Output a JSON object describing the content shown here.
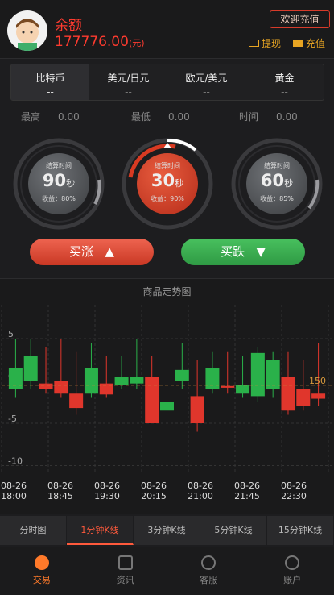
{
  "header": {
    "balance_label": "余额",
    "balance_value": "177776.00",
    "balance_unit": "(元)",
    "welcome_label": "欢迎充值",
    "withdraw_label": "提现",
    "recharge_label": "充值"
  },
  "market_tabs": [
    {
      "name": "比特币",
      "value": "--"
    },
    {
      "name": "美元/日元",
      "value": "--"
    },
    {
      "name": "欧元/美元",
      "value": "--"
    },
    {
      "name": "黄金",
      "value": "--"
    }
  ],
  "stats": {
    "high_label": "最高",
    "high_value": "0.00",
    "low_label": "最低",
    "low_value": "0.00",
    "time_label": "时间",
    "time_value": "0.00"
  },
  "dials": [
    {
      "title": "结算时间",
      "seconds": "90",
      "unit": "秒",
      "profit_label": "收益：80%"
    },
    {
      "title": "结算时间",
      "seconds": "30",
      "unit": "秒",
      "profit_label": "收益：90%"
    },
    {
      "title": "结算时间",
      "seconds": "60",
      "unit": "秒",
      "profit_label": "收益：85%"
    }
  ],
  "actions": {
    "buy_up_label": "买涨",
    "buy_up_icon": "▲",
    "buy_down_label": "买跌",
    "buy_down_icon": "▼"
  },
  "chart_data": {
    "type": "candlestick",
    "title": "商品走势图",
    "ylim": [
      -11,
      9
    ],
    "yticks": [
      "5",
      "0",
      "-5",
      "-10"
    ],
    "ytick_values": [
      5,
      0,
      -5,
      -10
    ],
    "reference_line": {
      "value": "150",
      "y": -0.5
    },
    "x_labels": [
      [
        "08-26",
        "18:00"
      ],
      [
        "08-26",
        "18:45"
      ],
      [
        "08-26",
        "19:30"
      ],
      [
        "08-26",
        "20:15"
      ],
      [
        "08-26",
        "21:00"
      ],
      [
        "08-26",
        "21:45"
      ],
      [
        "08-26",
        "22:30"
      ]
    ],
    "candles": [
      {
        "open": -1,
        "close": 1.5,
        "high": 5,
        "low": -2,
        "up": true
      },
      {
        "open": 0,
        "close": 3,
        "high": 5,
        "low": -1,
        "up": true
      },
      {
        "open": -0.3,
        "close": -1,
        "high": 4,
        "low": -1.5,
        "up": false
      },
      {
        "open": 0,
        "close": -1.5,
        "high": 5,
        "low": -2,
        "up": false
      },
      {
        "open": -1.5,
        "close": -3.2,
        "high": 3.5,
        "low": -4,
        "up": false
      },
      {
        "open": -1.5,
        "close": 1.5,
        "high": 4.5,
        "low": -2,
        "up": true
      },
      {
        "open": -0.3,
        "close": -1.6,
        "high": 3,
        "low": -2,
        "up": false
      },
      {
        "open": -0.5,
        "close": 0.5,
        "high": 3,
        "low": -1,
        "up": true
      },
      {
        "open": -0.3,
        "close": 0.5,
        "high": 5,
        "low": -1,
        "up": true
      },
      {
        "open": 0.5,
        "close": -5,
        "high": 3,
        "low": -5,
        "up": false
      },
      {
        "open": -3.5,
        "close": -2.5,
        "high": 3.5,
        "low": -4,
        "up": true
      },
      {
        "open": 0,
        "close": 1.3,
        "high": 4.5,
        "low": -1,
        "up": true
      },
      {
        "open": -1.8,
        "close": -5,
        "high": 2.5,
        "low": -6,
        "up": false
      },
      {
        "open": -1,
        "close": 1.5,
        "high": 3.5,
        "low": -1.5,
        "up": true
      },
      {
        "open": -0.6,
        "close": -0.8,
        "high": 3.5,
        "low": -1.5,
        "up": false
      },
      {
        "open": -1.5,
        "close": -0.5,
        "high": 3,
        "low": -2,
        "up": true
      },
      {
        "open": -1.8,
        "close": 3.3,
        "high": 4,
        "low": -2.5,
        "up": true
      },
      {
        "open": -1,
        "close": 2.5,
        "high": 3.5,
        "low": -2,
        "up": true
      },
      {
        "open": 0.5,
        "close": -3.5,
        "high": 3.5,
        "low": -4,
        "up": false
      },
      {
        "open": -1,
        "close": -3,
        "high": 2.5,
        "low": -3.5,
        "up": false
      },
      {
        "open": -1.5,
        "close": -2.1,
        "high": 4.5,
        "low": -3,
        "up": false
      }
    ]
  },
  "kline_tabs": [
    "分时图",
    "1分钟K线",
    "3分钟K线",
    "5分钟K线",
    "15分钟K线"
  ],
  "bottom_nav": [
    "交易",
    "资讯",
    "客服",
    "账户"
  ]
}
